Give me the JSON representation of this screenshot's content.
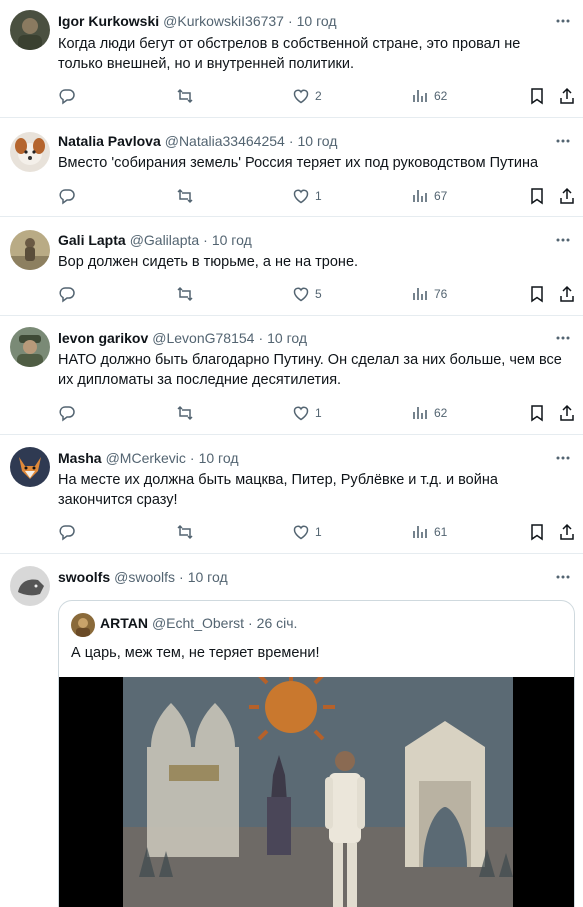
{
  "tweets": [
    {
      "name": "Igor Kurkowski",
      "handle": "@KurkowskiI36737",
      "time": "10 год",
      "text": "Когда люди бегут от обстрелов в собственной стране, это провал не только внешней, но и внутренней политики.",
      "likes": "2",
      "views": "62",
      "avatar_icon": "soldier-avatar"
    },
    {
      "name": "Natalia Pavlova",
      "handle": "@Natalia33464254",
      "time": "10 год",
      "text": "Вместо 'собирания земель' Россия теряет их под руководством Путина",
      "likes": "1",
      "views": "67",
      "avatar_icon": "dog-avatar"
    },
    {
      "name": "Gali Lapta",
      "handle": "@Galilapta",
      "time": "10 год",
      "text": "Вор должен сидеть в тюрьме, а не на троне.",
      "likes": "5",
      "views": "76",
      "avatar_icon": "person-outdoors-avatar"
    },
    {
      "name": "levon garikov",
      "handle": "@LevonG78154",
      "time": "10 год",
      "text": "НАТО должно быть благодарно Путину. Он сделал за них больше, чем все их дипломаты за последние десятилетия.",
      "likes": "1",
      "views": "62",
      "avatar_icon": "soldier-avatar"
    },
    {
      "name": "Masha",
      "handle": "@MCerkevic",
      "time": "10 год",
      "text": "На месте их должна быть мацква, Питер, Рублёвке и т.д. и война закончится сразу!",
      "likes": "1",
      "views": "61",
      "avatar_icon": "fox-avatar"
    },
    {
      "name": "swoolfs",
      "handle": "@swoolfs",
      "time": "10 год",
      "avatar_icon": "wolf-avatar"
    }
  ],
  "quote": {
    "name": "ARTAN",
    "handle": "@Echt_Oberst",
    "time": "26 січ.",
    "text": "А царь, меж тем, не теряет времени!",
    "media_icon": "video-still-singer-on-stage"
  },
  "separator": "·",
  "colors": {
    "text": "#0f1419",
    "secondary": "#536471",
    "border": "#e6ecf0"
  },
  "icons": [
    "reply-icon",
    "retweet-icon",
    "like-icon",
    "views-icon",
    "bookmark-icon",
    "share-icon",
    "more-icon"
  ]
}
